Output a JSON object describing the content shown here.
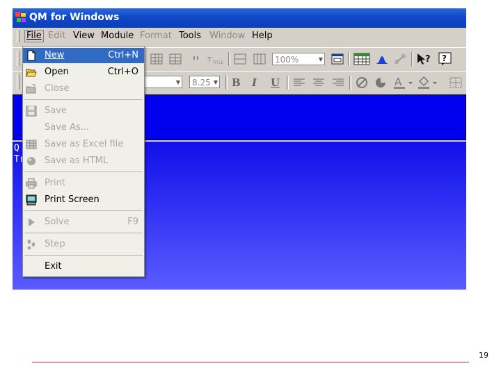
{
  "window": {
    "title": "QM for Windows"
  },
  "menubar": [
    {
      "label": "File",
      "state": "open"
    },
    {
      "label": "Edit",
      "state": "disabled"
    },
    {
      "label": "View",
      "state": "enabled"
    },
    {
      "label": "Module",
      "state": "enabled"
    },
    {
      "label": "Format",
      "state": "disabled"
    },
    {
      "label": "Tools",
      "state": "enabled"
    },
    {
      "label": "Window",
      "state": "disabled"
    },
    {
      "label": "Help",
      "state": "enabled"
    }
  ],
  "toolbar": {
    "zoom_value": "100%",
    "font_size_value": "8.25",
    "bold_label": "B",
    "italic_label": "I",
    "underline_label": "U",
    "title_button_label": "TITLE"
  },
  "sidebar_text": [
    "Q",
    "Tr"
  ],
  "file_menu": [
    {
      "label": "New",
      "shortcut": "Ctrl+N",
      "icon": "new-document-icon",
      "state": "highlighted"
    },
    {
      "label": "Open",
      "shortcut": "Ctrl+O",
      "icon": "open-folder-icon",
      "state": "enabled"
    },
    {
      "label": "Close",
      "shortcut": "",
      "icon": "close-folder-icon",
      "state": "disabled"
    },
    {
      "label": "Save",
      "shortcut": "",
      "icon": "save-disk-icon",
      "state": "disabled"
    },
    {
      "label": "Save As...",
      "shortcut": "",
      "icon": "",
      "state": "disabled"
    },
    {
      "label": "Save as Excel file",
      "shortcut": "",
      "icon": "excel-grid-icon",
      "state": "disabled"
    },
    {
      "label": "Save as HTML",
      "shortcut": "",
      "icon": "html-globe-icon",
      "state": "disabled"
    },
    {
      "label": "Print",
      "shortcut": "",
      "icon": "printer-icon",
      "state": "disabled"
    },
    {
      "label": "Print Screen",
      "shortcut": "",
      "icon": "print-screen-icon",
      "state": "enabled"
    },
    {
      "label": "Solve",
      "shortcut": "F9",
      "icon": "solve-play-icon",
      "state": "disabled"
    },
    {
      "label": "Step",
      "shortcut": "",
      "icon": "step-footprints-icon",
      "state": "disabled"
    },
    {
      "label": "Exit",
      "shortcut": "",
      "icon": "",
      "state": "enabled"
    }
  ],
  "slide": {
    "page_number": "19"
  },
  "colors": {
    "title_bar": "#0f48c8",
    "highlight": "#316ac5",
    "workspace_blue": "#0000ee",
    "footer_line": "#c43333"
  }
}
